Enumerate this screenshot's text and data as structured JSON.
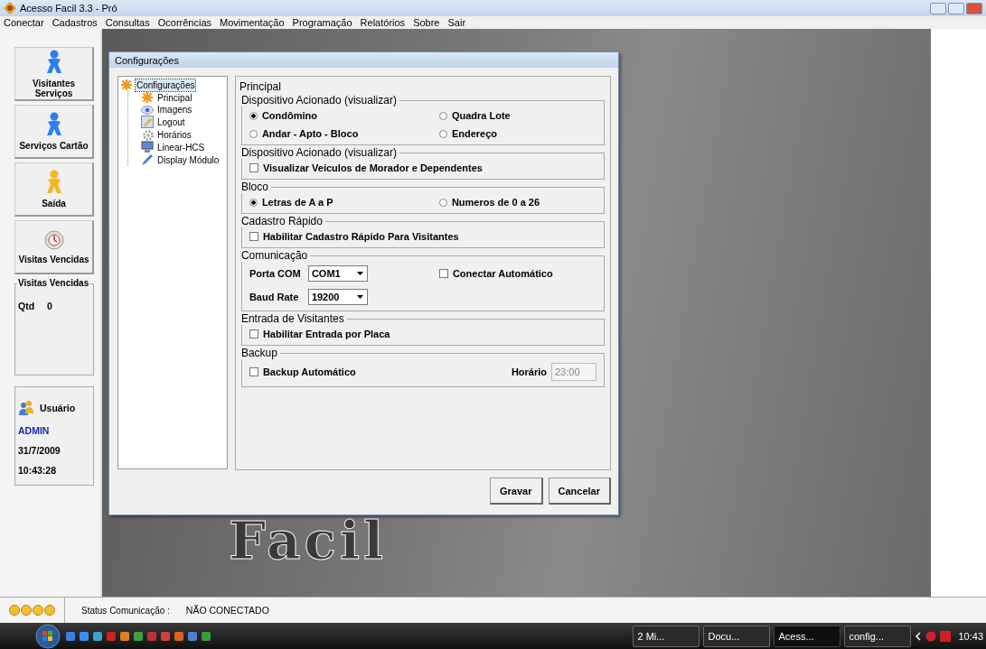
{
  "window": {
    "title": "Acesso Facil 3.3  -  Pró"
  },
  "menu": [
    "Conectar",
    "Cadastros",
    "Consultas",
    "Ocorrências",
    "Movimentação",
    "Programação",
    "Relatórios",
    "Sobre",
    "Sair"
  ],
  "sidebar": {
    "buttons": [
      {
        "label": "Visitantes Serviços",
        "kind": "blue"
      },
      {
        "label": "Serviços Cartão",
        "kind": "blue"
      },
      {
        "label": "Saída",
        "kind": "yellow"
      },
      {
        "label": "Visitas Vencidas",
        "kind": "clock"
      }
    ],
    "visitas_panel": {
      "title": "Visitas Vencidas",
      "label": "Qtd",
      "value": "0"
    },
    "user_panel": {
      "title": "Usuário",
      "user": "ADMIN",
      "date": "31/7/2009",
      "time": "10:43:28"
    }
  },
  "background_logo": "Facil",
  "dialog": {
    "title": "Configurações",
    "tree": {
      "label": "Configurações",
      "selected": true,
      "children": [
        {
          "label": "Principal",
          "selected": false
        },
        {
          "label": "Imagens",
          "selected": false
        },
        {
          "label": "Logout",
          "selected": false
        },
        {
          "label": "Horários",
          "selected": false
        },
        {
          "label": "Linear-HCS",
          "selected": false
        },
        {
          "label": "Display Módulo",
          "selected": false
        }
      ]
    },
    "section_title": "Principal",
    "groups": [
      {
        "title": "Dispositivo Acionado (visualizar)",
        "controls": [
          {
            "kind": "radio",
            "label": "Condômino",
            "selected": true
          },
          {
            "kind": "radio",
            "label": "Quadra Lote",
            "selected": false
          },
          {
            "kind": "radio",
            "label": "Andar - Apto - Bloco",
            "selected": false
          },
          {
            "kind": "radio",
            "label": "Endereço",
            "selected": false
          }
        ]
      },
      {
        "title": "Dispositivo Acionado (visualizar)",
        "controls": [
          {
            "kind": "checkbox",
            "label": "Visualizar Veículos de Morador e Dependentes",
            "checked": false
          }
        ]
      },
      {
        "title": "Bloco",
        "controls": [
          {
            "kind": "radio",
            "label": "Letras de A a P",
            "selected": true
          },
          {
            "kind": "radio",
            "label": "Numeros de 0 a 26",
            "selected": false
          }
        ]
      },
      {
        "title": "Cadastro Rápido",
        "controls": [
          {
            "kind": "checkbox",
            "label": "Habilitar Cadastro Rápido Para Visitantes",
            "checked": false
          }
        ]
      },
      {
        "title": "Comunicação",
        "controls": [
          {
            "kind": "select",
            "label": "Porta COM",
            "value": "COM1"
          },
          {
            "kind": "checkbox",
            "label": "Conectar Automático",
            "checked": false
          },
          {
            "kind": "select",
            "label": "Baud Rate",
            "value": "19200"
          }
        ]
      },
      {
        "title": "Entrada de Visitantes",
        "controls": [
          {
            "kind": "checkbox",
            "label": "Habilitar Entrada por Placa",
            "checked": false
          }
        ]
      },
      {
        "title": "Backup",
        "controls": [
          {
            "kind": "checkbox",
            "label": "Backup Automático",
            "checked": false
          },
          {
            "kind": "text",
            "label": "Horário",
            "value": "23:00",
            "disabled": true
          }
        ]
      }
    ],
    "buttons": [
      "Gravar",
      "Cancelar"
    ]
  },
  "status_bar": {
    "label": "Status Comunicação :",
    "value": "NÃO CONECTADO"
  },
  "taskbar": {
    "tasks": [
      {
        "label": "2 Mi...",
        "selected": false
      },
      {
        "label": "Docu...",
        "selected": false
      },
      {
        "label": "Acess...",
        "selected": true
      },
      {
        "label": "config...",
        "selected": false
      }
    ],
    "clock": "10:43"
  }
}
